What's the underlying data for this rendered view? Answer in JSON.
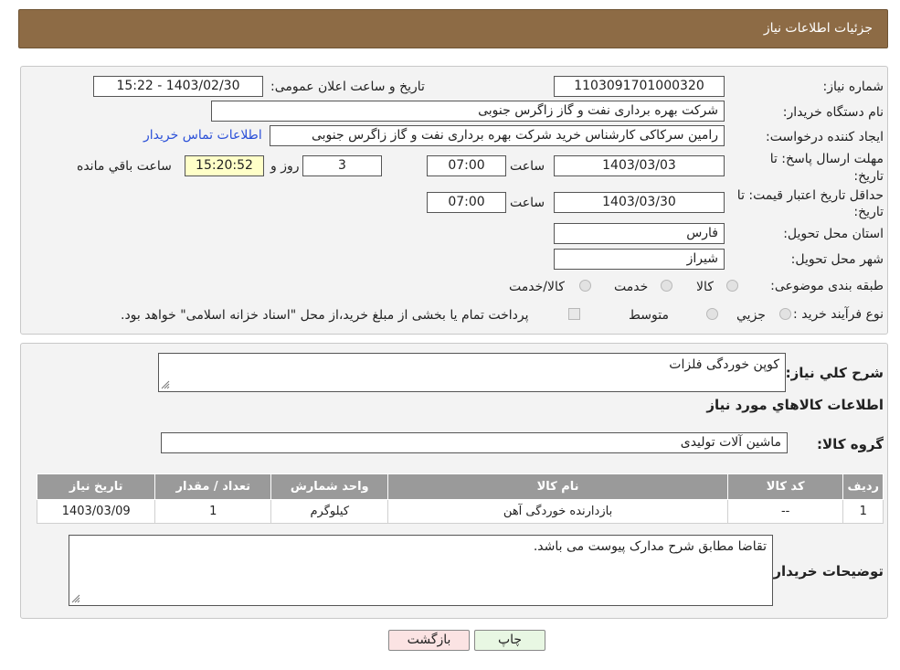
{
  "header": {
    "title": "جزئیات اطلاعات نیاز"
  },
  "form": {
    "need_number_label": "شماره نیاز:",
    "need_number": "1103091701000320",
    "announce_label": "تاریخ و ساعت اعلان عمومی:",
    "announce_value": "1403/02/30 - 15:22",
    "buyer_org_label": "نام دستگاه خریدار:",
    "buyer_org": "شرکت بهره برداری نفت و گاز زاگرس جنوبی",
    "creator_label": "ایجاد کننده درخواست:",
    "creator": "رامین سرکاکی کارشناس خرید شرکت بهره برداری نفت و گاز زاگرس جنوبی",
    "contact_link": "اطلاعات تماس خریدار",
    "deadline_label_1": "مهلت ارسال پاسخ: تا",
    "deadline_label_2": "تاریخ:",
    "deadline_date": "1403/03/03",
    "time_label": "ساعت",
    "deadline_time": "07:00",
    "days": "3",
    "days_label": "روز و",
    "remaining_time": "15:20:52",
    "remaining_label": "ساعت باقي مانده",
    "validity_label_1": "حداقل تاریخ اعتبار قیمت: تا",
    "validity_label_2": "تاریخ:",
    "validity_date": "1403/03/30",
    "validity_time": "07:00",
    "province_label": "استان محل تحویل:",
    "province": "فارس",
    "city_label": "شهر محل تحویل:",
    "city": "شیراز",
    "category_label": "طبقه بندی موضوعی:",
    "category_options": [
      "کالا",
      "خدمت",
      "کالا/خدمت"
    ],
    "process_label": "نوع فرآیند خرید :",
    "process_options": [
      "جزيي",
      "متوسط"
    ],
    "payment_note": "پرداخت تمام یا بخشی از مبلغ خرید،از محل \"اسناد خزانه اسلامی\" خواهد بود."
  },
  "details": {
    "description_label": "شرح کلي نياز:",
    "description": "کوپن خوردگی فلزات",
    "goods_info_title": "اطلاعات کالاهاي مورد نياز",
    "goods_group_label": "گروه کالا:",
    "goods_group": "ماشین آلات تولیدی",
    "table": {
      "headers": [
        "رديف",
        "کد کالا",
        "نام کالا",
        "واحد شمارش",
        "تعداد / مقدار",
        "تاریخ نیاز"
      ],
      "rows": [
        [
          "1",
          "--",
          "بازدارنده خوردگی آهن",
          "کیلوگرم",
          "1",
          "1403/03/09"
        ]
      ]
    },
    "buyer_notes_label": "توضیحات خریدار:",
    "buyer_notes": "تقاضا مطابق شرح مدارک پیوست می باشد."
  },
  "buttons": {
    "print": "چاپ",
    "back": "بازگشت"
  },
  "colors": {
    "header": "#8d6b45",
    "back_button": "#fbe3e3",
    "print_button": "#e8f7e3",
    "remaining_box": "#ffffc8"
  }
}
